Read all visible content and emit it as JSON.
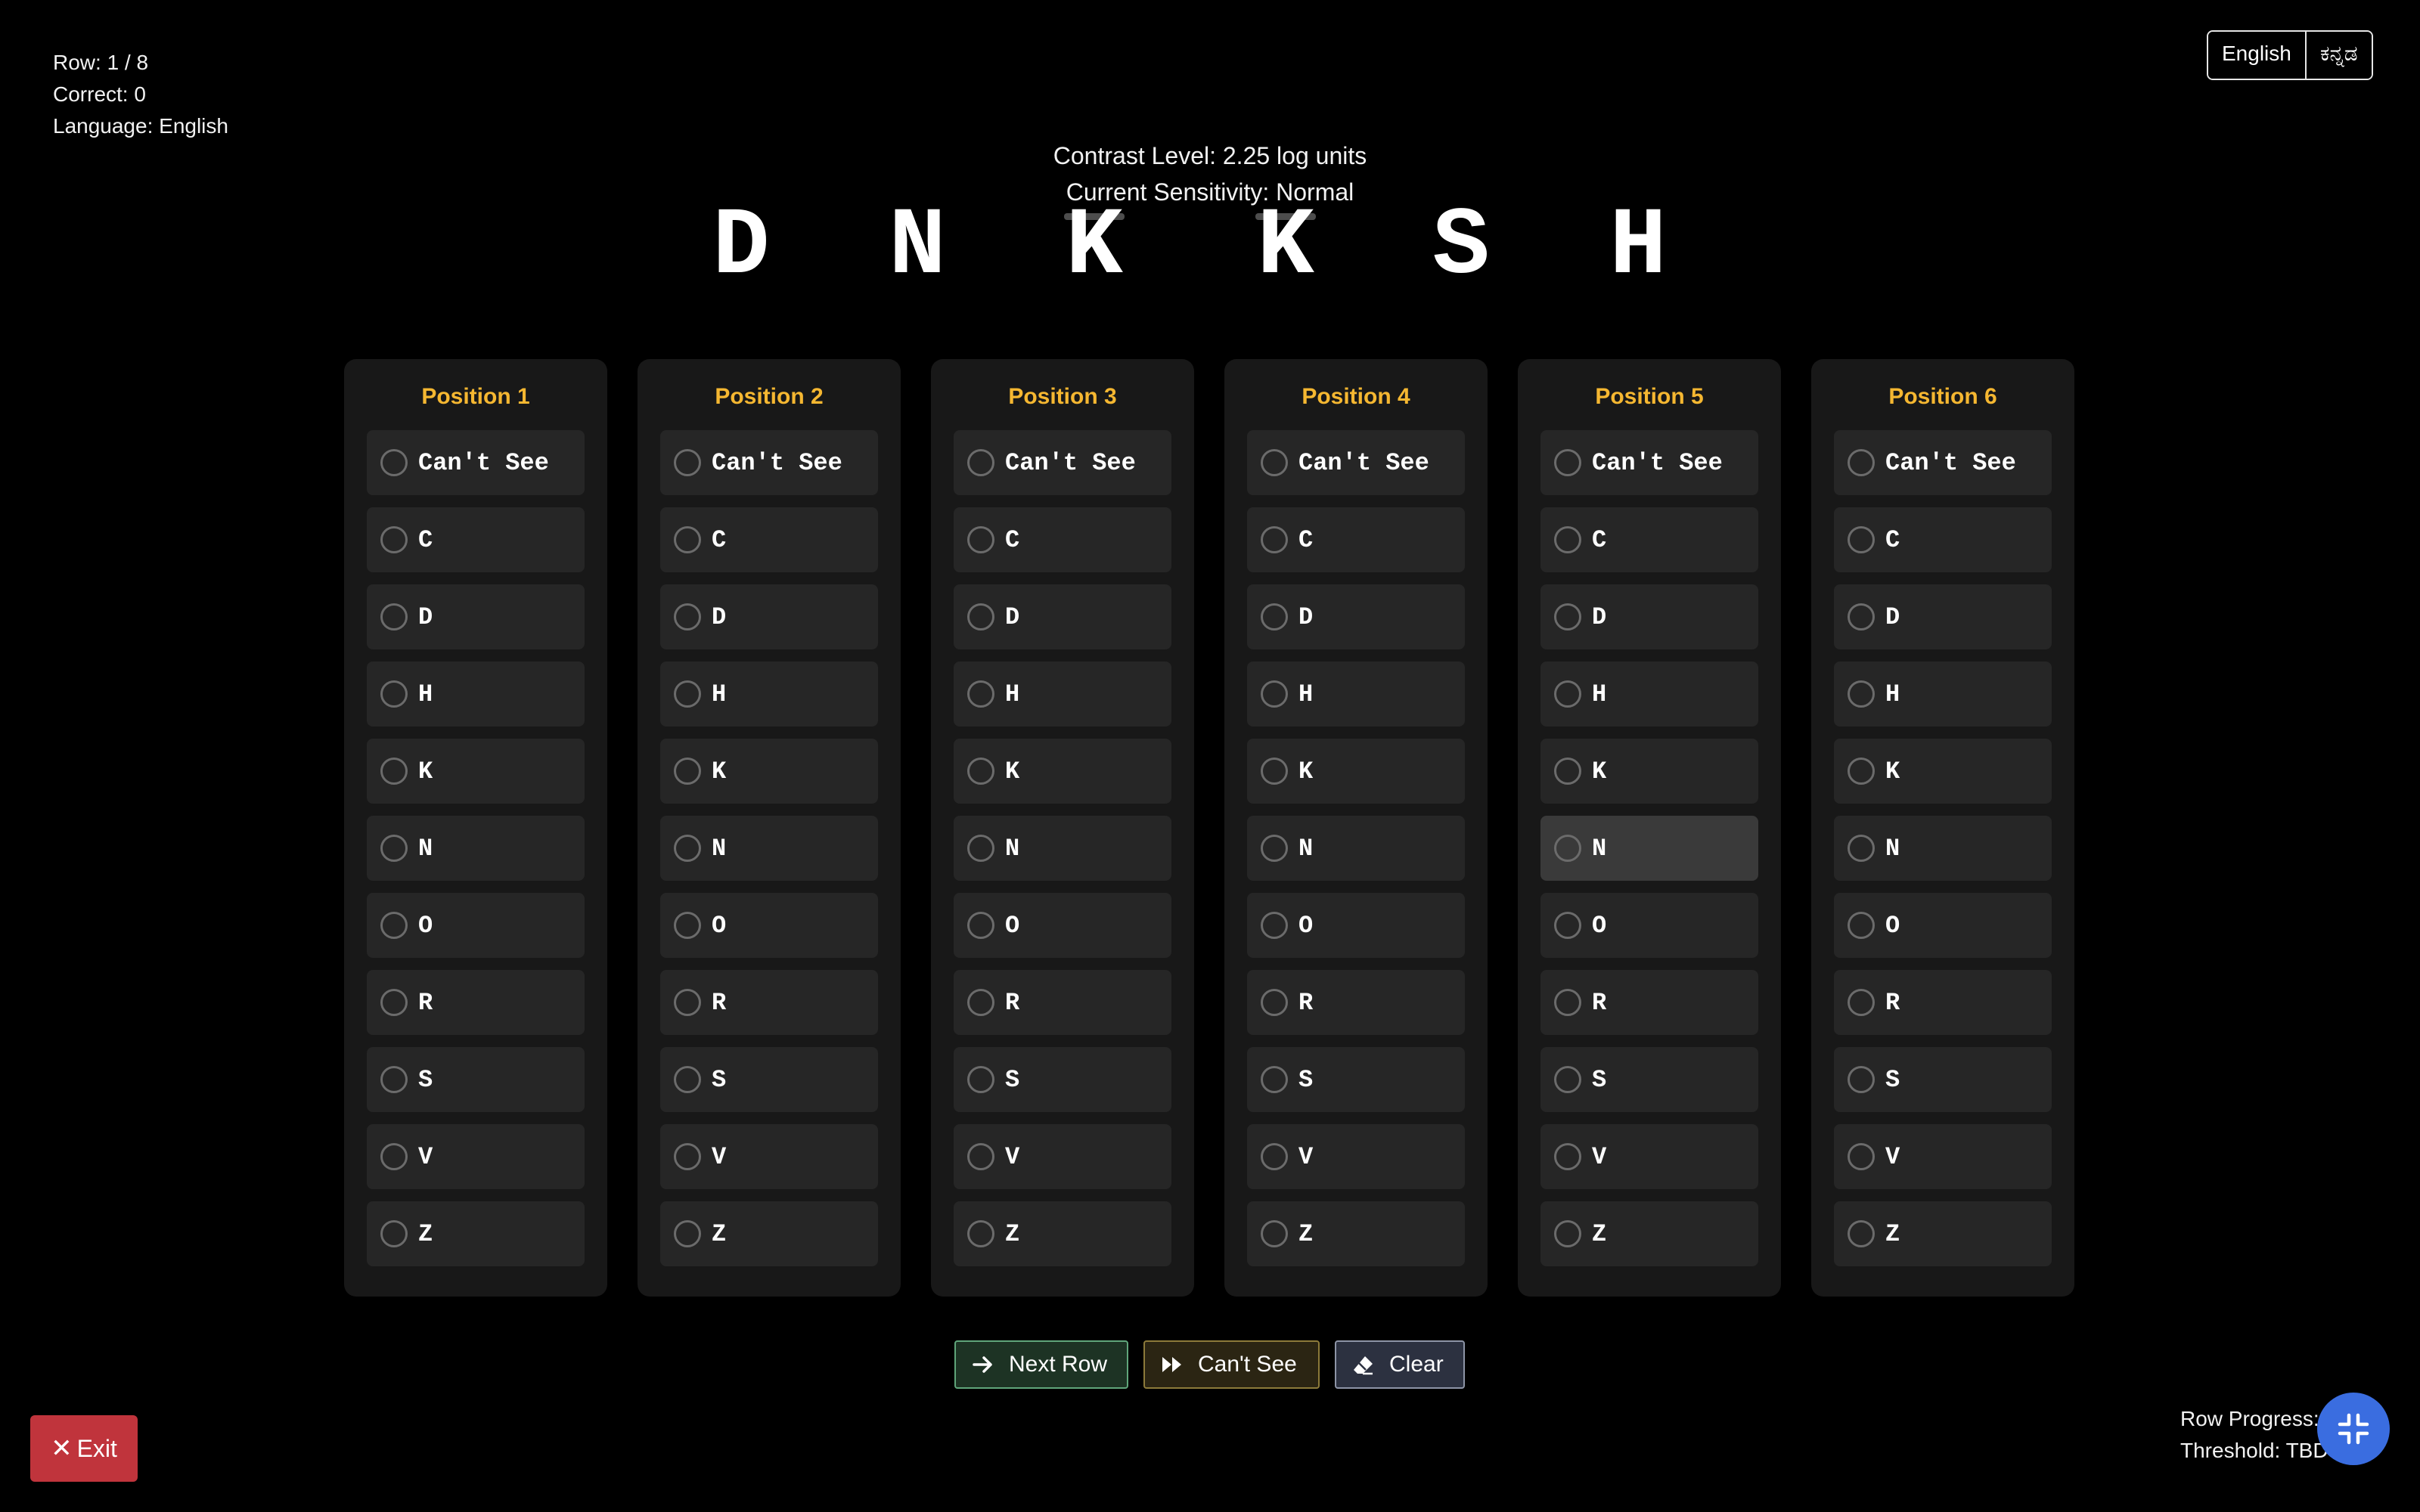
{
  "status": {
    "row": "Row: 1 / 8",
    "correct": "Correct: 0",
    "language": "Language: English"
  },
  "language_toggle": {
    "english": "English",
    "kannada": "ಕನ್ನಡ"
  },
  "header": {
    "contrast": "Contrast Level: 2.25 log units",
    "sensitivity": "Current Sensitivity: Normal"
  },
  "chart_letters": [
    "D",
    "N",
    "K",
    "K",
    "S",
    "H"
  ],
  "columns": [
    {
      "title": "Position 1",
      "options": [
        "Can't See",
        "C",
        "D",
        "H",
        "K",
        "N",
        "O",
        "R",
        "S",
        "V",
        "Z"
      ]
    },
    {
      "title": "Position 2",
      "options": [
        "Can't See",
        "C",
        "D",
        "H",
        "K",
        "N",
        "O",
        "R",
        "S",
        "V",
        "Z"
      ]
    },
    {
      "title": "Position 3",
      "options": [
        "Can't See",
        "C",
        "D",
        "H",
        "K",
        "N",
        "O",
        "R",
        "S",
        "V",
        "Z"
      ]
    },
    {
      "title": "Position 4",
      "options": [
        "Can't See",
        "C",
        "D",
        "H",
        "K",
        "N",
        "O",
        "R",
        "S",
        "V",
        "Z"
      ]
    },
    {
      "title": "Position 5",
      "options": [
        "Can't See",
        "C",
        "D",
        "H",
        "K",
        "N",
        "O",
        "R",
        "S",
        "V",
        "Z"
      ]
    },
    {
      "title": "Position 6",
      "options": [
        "Can't See",
        "C",
        "D",
        "H",
        "K",
        "N",
        "O",
        "R",
        "S",
        "V",
        "Z"
      ]
    }
  ],
  "actions": {
    "next_row": "Next Row",
    "cant_see": "Can't See",
    "clear": "Clear",
    "exit": "Exit"
  },
  "footer": {
    "row_progress": "Row Progress: 1/12",
    "threshold": "Threshold: TBD"
  },
  "colors": {
    "accent_gold": "#f5b731",
    "exit_red": "#c0343c",
    "fab_blue": "#3a6de0",
    "next_green": "#5fa57a"
  },
  "icons": {
    "next": "arrow-right-icon",
    "cant_see": "fast-forward-icon",
    "clear": "eraser-icon",
    "exit": "close-icon",
    "fab": "collapse-icon"
  }
}
